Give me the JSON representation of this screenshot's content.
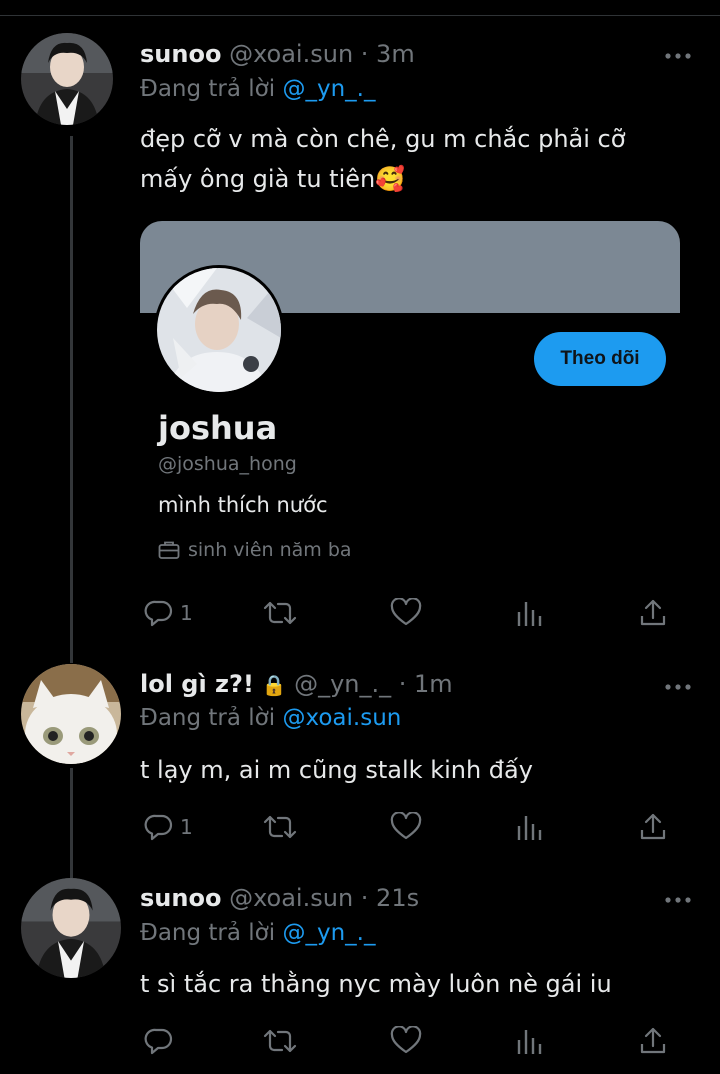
{
  "tweets": [
    {
      "name": "sunoo",
      "handle": "@xoai.sun",
      "time": "· 3m",
      "reply_prefix": "Đang trả lời",
      "reply_to": "@_yn_._",
      "text_line1": "đẹp cỡ v mà còn chê, gu m chắc phải cỡ",
      "text_line2": "mấy ông già tu tiên🥰",
      "reply_count": "1"
    },
    {
      "name": "lol gì z?!",
      "lock_icon": "🔒",
      "handle": "@_yn_._",
      "time": "· 1m",
      "reply_prefix": "Đang trả lời",
      "reply_to": "@xoai.sun",
      "text_line1": "t lạy m, ai m cũng stalk kinh đấy",
      "reply_count": "1"
    },
    {
      "name": "sunoo",
      "handle": "@xoai.sun",
      "time": "· 21s",
      "reply_prefix": "Đang trả lời",
      "reply_to": "@_yn_._",
      "text_line1": "t sì tắc ra thằng nyc mày luôn nè gái iu",
      "reply_count": ""
    }
  ],
  "profile_card": {
    "name": "joshua",
    "handle": "@joshua_hong",
    "bio": "mình thích nước",
    "job": "sinh viên năm ba",
    "follow_label": "Theo dõi"
  },
  "icons": [
    "reply-icon",
    "retweet-icon",
    "like-icon",
    "views-icon",
    "share-icon",
    "more-icon",
    "briefcase-icon",
    "lock-icon"
  ],
  "colors": {
    "accent": "#1d9bf0",
    "muted": "#71767b",
    "banner": "#7c8894"
  }
}
